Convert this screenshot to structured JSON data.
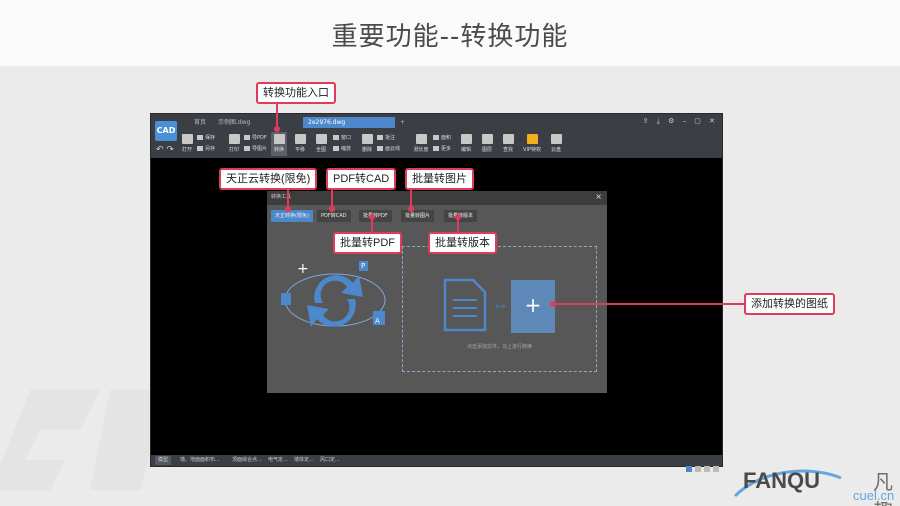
{
  "slide": {
    "title": "重要功能--转换功能"
  },
  "app": {
    "doc_tabs": [
      "首页",
      "示例图.dwg",
      "2e2976.dwg",
      "+"
    ],
    "window_controls": "⇪ ⤓ ⚙ – ▢ ✕",
    "toolbar": {
      "logo": "CAD",
      "undo_redo": "↶ ↷",
      "items": [
        {
          "label": "打开",
          "icon": "folder-icon"
        },
        {
          "label": "保存",
          "icon": "save-icon"
        },
        {
          "label": "另存",
          "icon": "save-as-icon"
        },
        {
          "label": "打印",
          "icon": "print-icon"
        },
        {
          "label": "导PDF",
          "icon": "pdf-icon"
        },
        {
          "label": "导图片",
          "icon": "image-icon"
        },
        {
          "label": "转换",
          "icon": "convert-icon"
        },
        {
          "label": "平移",
          "icon": "hand-icon"
        },
        {
          "label": "全图",
          "icon": "fit-icon"
        },
        {
          "label": "窗口",
          "icon": "window-zoom-icon"
        },
        {
          "label": "缩放",
          "icon": "zoom-icon"
        },
        {
          "label": "删除",
          "icon": "delete-icon"
        },
        {
          "label": "批注",
          "icon": "annotate-icon"
        },
        {
          "label": "画云线",
          "icon": "cloud-line-icon"
        },
        {
          "label": "测长度",
          "icon": "measure-icon"
        },
        {
          "label": "面积",
          "icon": "area-icon"
        },
        {
          "label": "更多",
          "icon": "more-icon"
        },
        {
          "label": "编辑",
          "icon": "edit-icon"
        },
        {
          "label": "图层",
          "icon": "layers-icon"
        },
        {
          "label": "查找",
          "icon": "search-icon"
        },
        {
          "label": "VIP特权",
          "icon": "vip-icon"
        },
        {
          "label": "云盘",
          "icon": "cloud-icon"
        }
      ]
    },
    "status_tabs": [
      "模型",
      "墙、地面面积布...",
      "顶面综合点...",
      "电气定...",
      "墙体定...",
      "风口定..."
    ],
    "dialog": {
      "title": "转换工具",
      "close": "×",
      "tabs": [
        "天正转换(限免)",
        "PDF转CAD",
        "批量转PDF",
        "批量转图片",
        "批量转版本"
      ],
      "add": "+",
      "hint": "点击添加文件，马上进行转换",
      "arrows": "»»",
      "icon_letters": {
        "pdf": "P",
        "cad": "A",
        "plus": "+"
      }
    }
  },
  "callouts": {
    "entry": "转换功能入口",
    "tianzheng": "天正云转换(限免)",
    "pdf_to_cad": "PDF转CAD",
    "batch_image": "批量转图片",
    "batch_pdf": "批量转PDF",
    "batch_version": "批量转版本",
    "add_drawing": "添加转换的图纸"
  },
  "brand": {
    "name": "FANQU",
    "name_cn": "凡趣",
    "url": "cuel.cn"
  },
  "colors": {
    "accent_blue": "#4d88cc",
    "callout_red": "#e03c5a",
    "toolbar_bg": "#3b3f45",
    "vip_gold": "#f2b01e"
  }
}
